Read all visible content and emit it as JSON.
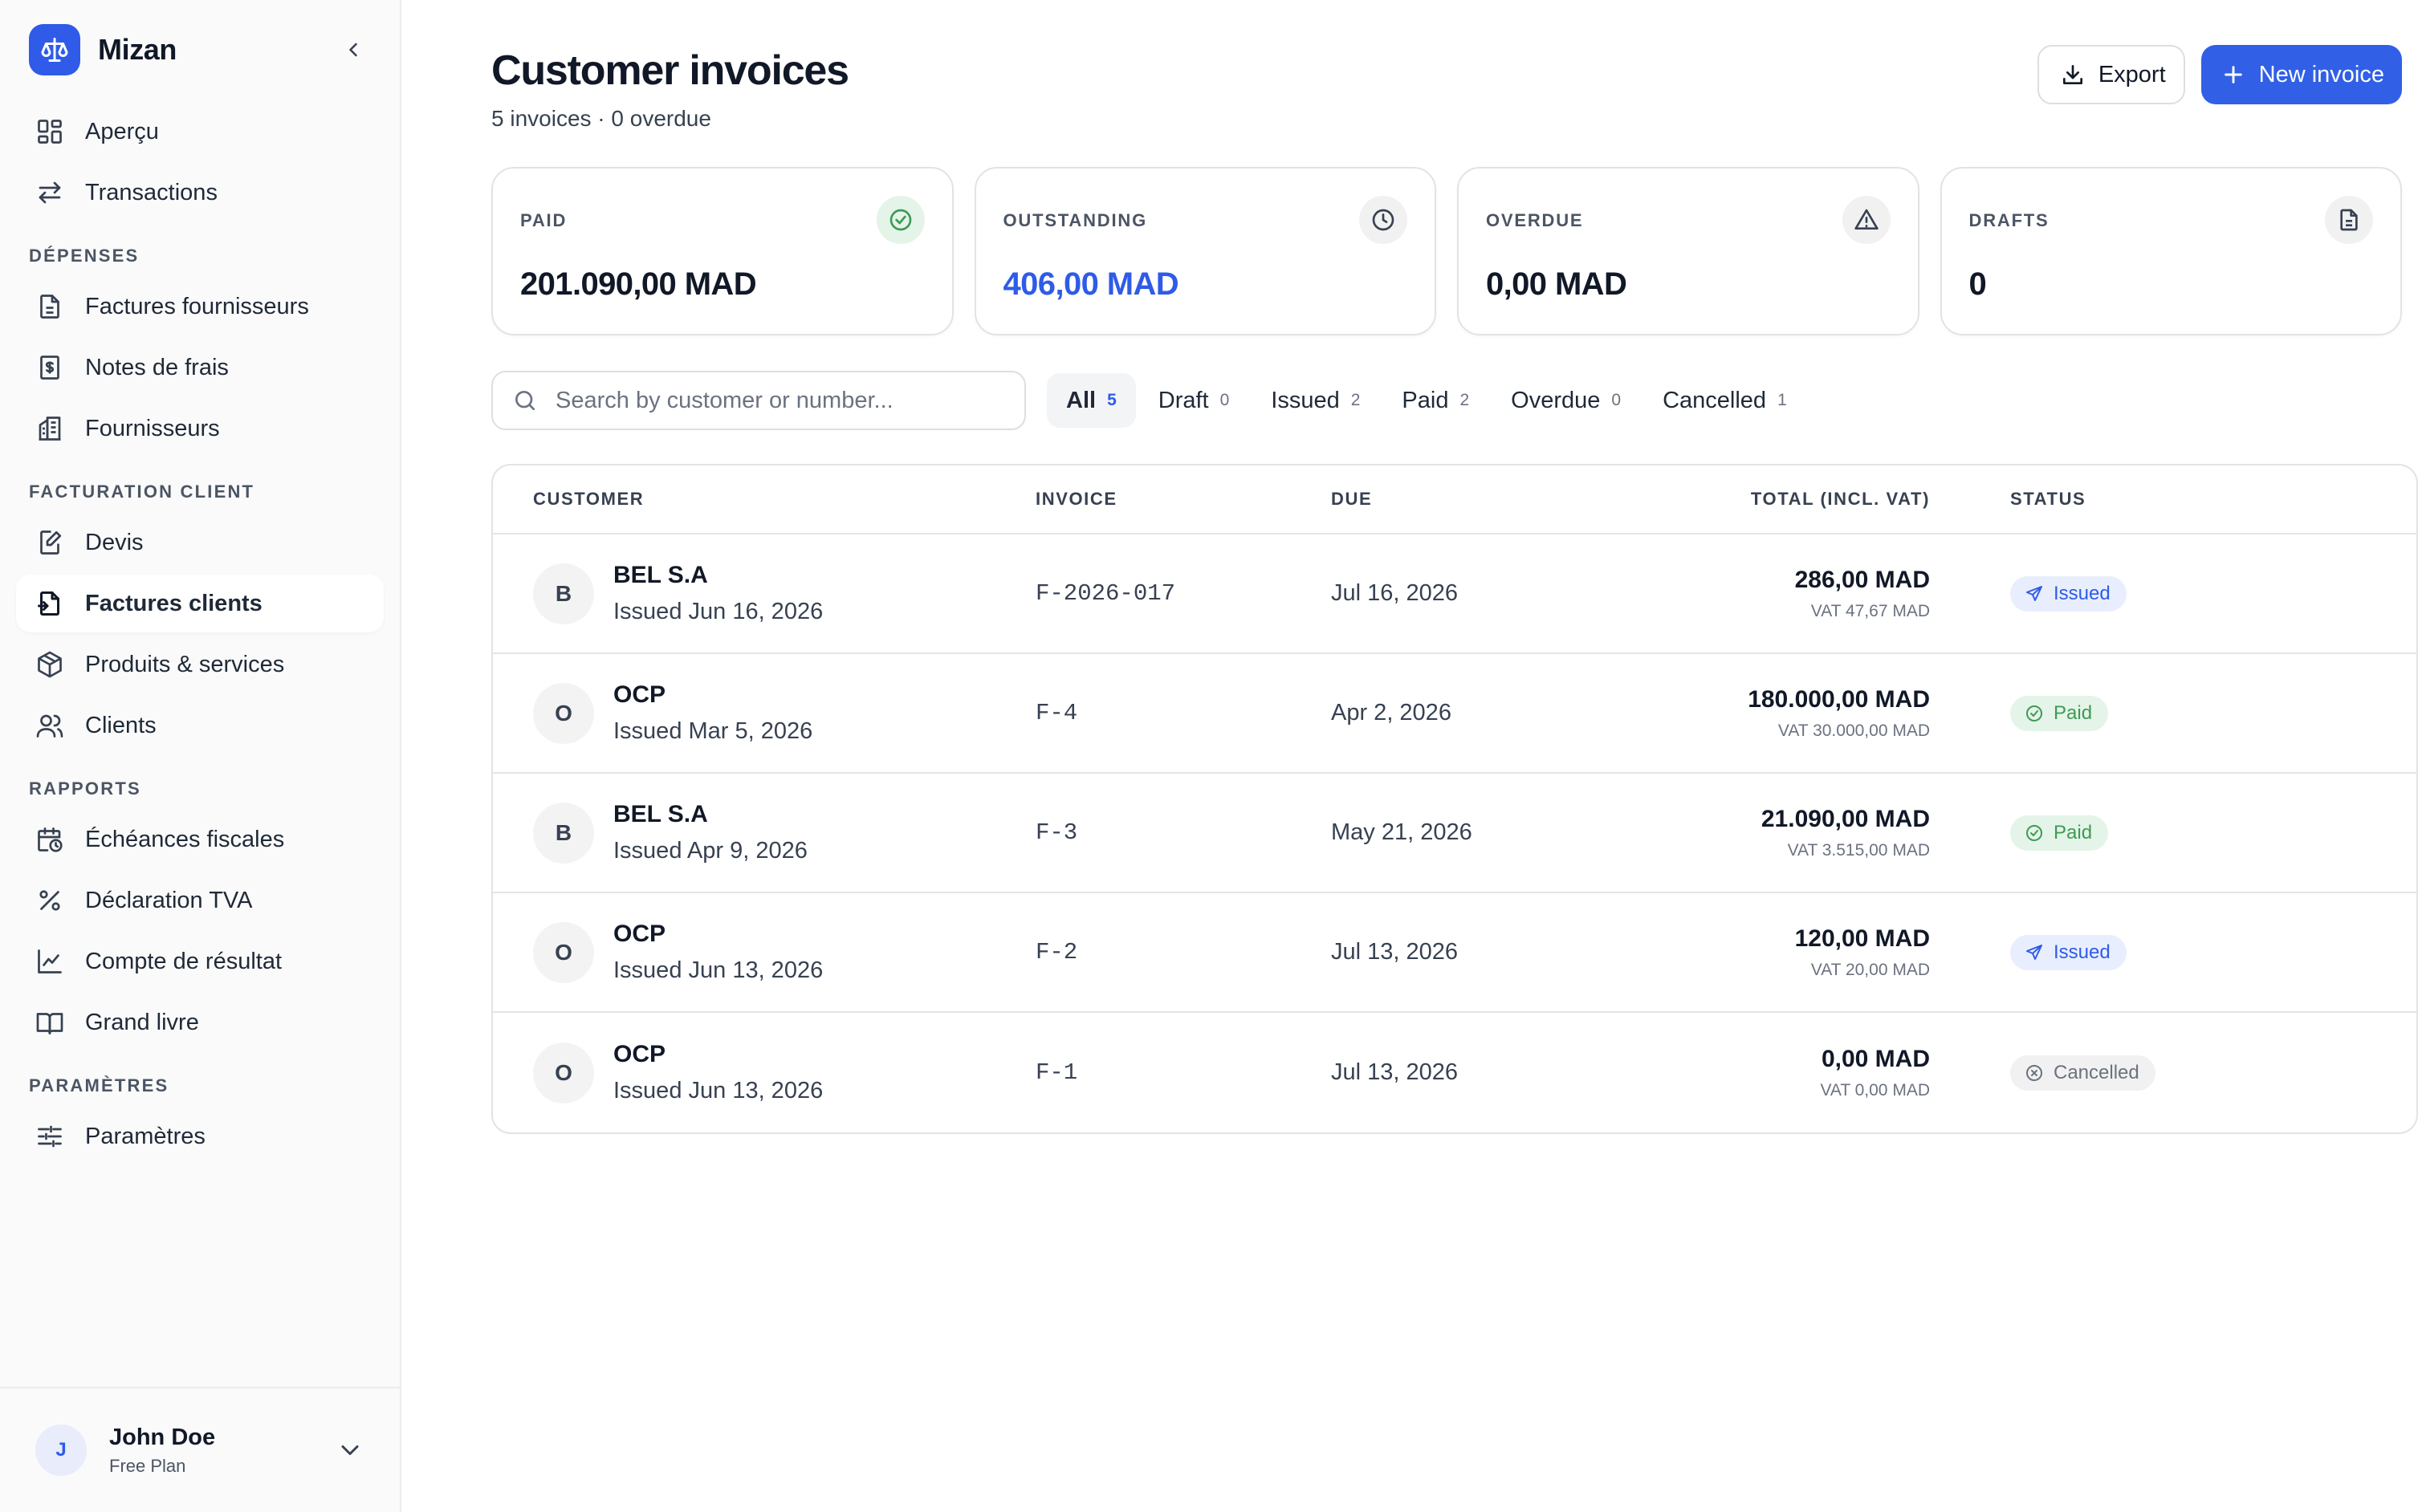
{
  "app": {
    "name": "Mizan"
  },
  "sidebar": {
    "primary": [
      {
        "label": "Aperçu",
        "icon": "dashboard-icon"
      },
      {
        "label": "Transactions",
        "icon": "transfer-icon"
      }
    ],
    "sections": [
      {
        "title": "DÉPENSES",
        "items": [
          {
            "label": "Factures fournisseurs",
            "icon": "document-icon"
          },
          {
            "label": "Notes de frais",
            "icon": "receipt-icon"
          },
          {
            "label": "Fournisseurs",
            "icon": "building-icon"
          }
        ]
      },
      {
        "title": "FACTURATION CLIENT",
        "items": [
          {
            "label": "Devis",
            "icon": "edit-document-icon"
          },
          {
            "label": "Factures clients",
            "icon": "invoice-icon",
            "active": true
          },
          {
            "label": "Produits & services",
            "icon": "box-icon"
          },
          {
            "label": "Clients",
            "icon": "users-icon"
          }
        ]
      },
      {
        "title": "RAPPORTS",
        "items": [
          {
            "label": "Échéances fiscales",
            "icon": "calendar-clock-icon"
          },
          {
            "label": "Déclaration TVA",
            "icon": "percent-icon"
          },
          {
            "label": "Compte de résultat",
            "icon": "line-chart-icon"
          },
          {
            "label": "Grand livre",
            "icon": "book-icon"
          }
        ]
      },
      {
        "title": "PARAMÈTRES",
        "items": [
          {
            "label": "Paramètres",
            "icon": "sliders-icon"
          }
        ]
      }
    ],
    "user": {
      "initial": "J",
      "name": "John Doe",
      "plan": "Free Plan"
    }
  },
  "header": {
    "title": "Customer invoices",
    "subtitle": "5 invoices · 0 overdue",
    "export_label": "Export",
    "new_label": "New invoice"
  },
  "stats": [
    {
      "label": "PAID",
      "value": "201.090,00 MAD",
      "icon": "check-circle-icon"
    },
    {
      "label": "OUTSTANDING",
      "value": "406,00 MAD",
      "icon": "clock-icon"
    },
    {
      "label": "OVERDUE",
      "value": "0,00 MAD",
      "icon": "warning-icon"
    },
    {
      "label": "DRAFTS",
      "value": "0",
      "icon": "file-icon"
    }
  ],
  "search": {
    "placeholder": "Search by customer or number..."
  },
  "tabs": [
    {
      "label": "All",
      "count": "5",
      "active": true
    },
    {
      "label": "Draft",
      "count": "0"
    },
    {
      "label": "Issued",
      "count": "2"
    },
    {
      "label": "Paid",
      "count": "2"
    },
    {
      "label": "Overdue",
      "count": "0"
    },
    {
      "label": "Cancelled",
      "count": "1"
    }
  ],
  "table": {
    "headers": {
      "customer": "CUSTOMER",
      "invoice": "INVOICE",
      "due": "DUE",
      "total": "TOTAL (INCL. VAT)",
      "status": "STATUS"
    },
    "rows": [
      {
        "initial": "B",
        "customer": "BEL S.A",
        "issued": "Issued Jun 16, 2026",
        "invoice": "F-2026-017",
        "due": "Jul 16, 2026",
        "total": "286,00 MAD",
        "vat": "VAT 47,67 MAD",
        "status": "Issued"
      },
      {
        "initial": "O",
        "customer": "OCP",
        "issued": "Issued Mar 5, 2026",
        "invoice": "F-4",
        "due": "Apr 2, 2026",
        "total": "180.000,00 MAD",
        "vat": "VAT 30.000,00 MAD",
        "status": "Paid"
      },
      {
        "initial": "B",
        "customer": "BEL S.A",
        "issued": "Issued Apr 9, 2026",
        "invoice": "F-3",
        "due": "May 21, 2026",
        "total": "21.090,00 MAD",
        "vat": "VAT 3.515,00 MAD",
        "status": "Paid"
      },
      {
        "initial": "O",
        "customer": "OCP",
        "issued": "Issued Jun 13, 2026",
        "invoice": "F-2",
        "due": "Jul 13, 2026",
        "total": "120,00 MAD",
        "vat": "VAT 20,00 MAD",
        "status": "Issued"
      },
      {
        "initial": "O",
        "customer": "OCP",
        "issued": "Issued Jun 13, 2026",
        "invoice": "F-1",
        "due": "Jul 13, 2026",
        "total": "0,00 MAD",
        "vat": "VAT 0,00 MAD",
        "status": "Cancelled"
      }
    ]
  },
  "colors": {
    "accent": "#2f5be8",
    "paid": "#3f9a55",
    "cancelled": "#6b7280"
  }
}
